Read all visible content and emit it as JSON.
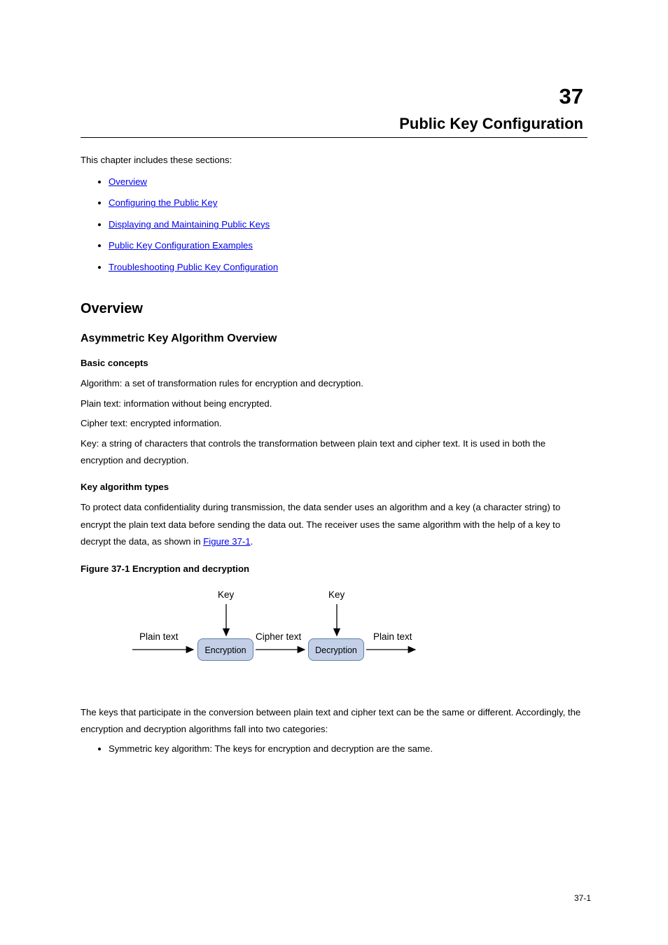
{
  "chapterNum": "37",
  "chapterTitle": "Public Key Configuration",
  "tocIntro": "This chapter includes these sections:",
  "toc": [
    "Overview",
    "Configuring the Public Key",
    "Displaying and Maintaining Public Keys",
    "Public Key Configuration Examples",
    "Troubleshooting Public Key Configuration"
  ],
  "sec1": "Overview",
  "p1": "To protect data confidentiality during transmission, the data sender uses an algorithm and a key (a character string) to encrypt the plain text data before sending the data out. The receiver uses the same algorithm with the help of a key to decrypt the data, as shown in ",
  "p1linkText": "Figure 37-1",
  "p1end": ".",
  "p2": "The keys that participate in the conversion between plain text and cipher text can be the same or different. Accordingly, the encryption and decryption algorithms fall into two categories:",
  "sec11": "Asymmetric Key Algorithm Overview",
  "subA": "Basic concepts",
  "basics": [
    "Algorithm: a set of transformation rules for encryption and decryption.",
    "Plain text: information without being encrypted.",
    "Cipher text: encrypted information.",
    "Key: a string of characters that controls the transformation between plain text and cipher text. It is used in both the encryption and decryption."
  ],
  "subB": "Key algorithm types",
  "figCaption": "Figure 37-1 Encryption and decryption",
  "diagram": {
    "key1": "Key",
    "key2": "Key",
    "plain1": "Plain text",
    "enc": "Encryption",
    "cipher": "Cipher text",
    "dec": "Decryption",
    "plain2": "Plain text"
  },
  "sym": [
    "Symmetric key algorithm: The keys for encryption and decryption are the same."
  ],
  "pageNum": "37-1"
}
